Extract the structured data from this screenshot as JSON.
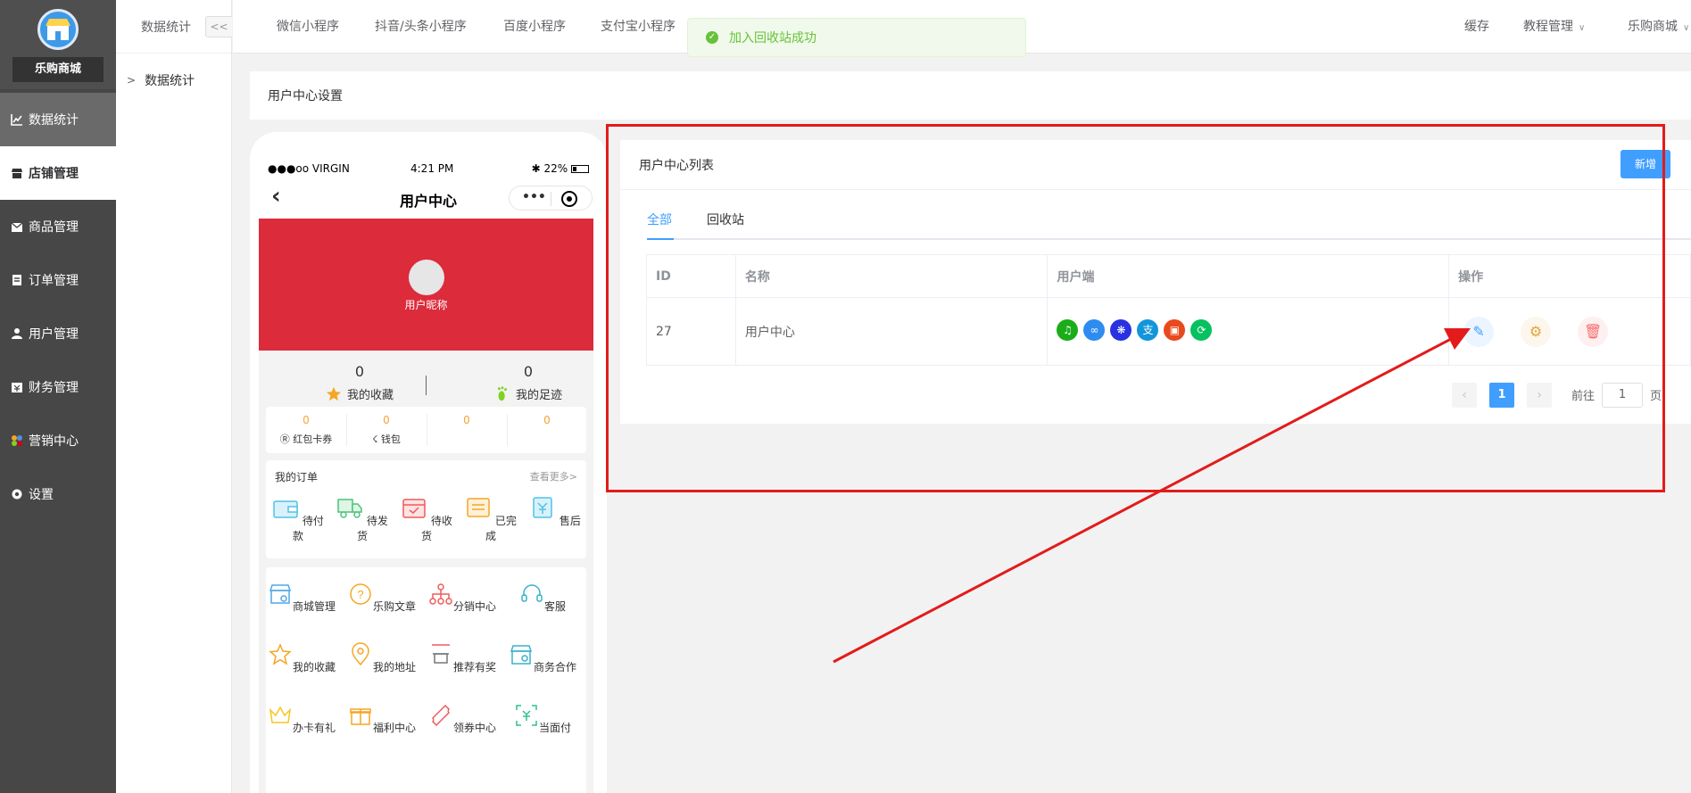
{
  "sidebar": {
    "brand": "乐购商城",
    "items": [
      {
        "label": "数据统计"
      },
      {
        "label": "店铺管理"
      },
      {
        "label": "商品管理"
      },
      {
        "label": "订单管理"
      },
      {
        "label": "用户管理"
      },
      {
        "label": "财务管理"
      },
      {
        "label": "营销中心"
      },
      {
        "label": "设置"
      }
    ]
  },
  "subnav": {
    "title": "数据统计",
    "collapse": "<<",
    "item": "数据统计"
  },
  "topbar": {
    "tabs": [
      "微信小程序",
      "抖音/头条小程序",
      "百度小程序",
      "支付宝小程序"
    ],
    "right": [
      "缓存",
      "教程管理",
      "乐购商城"
    ]
  },
  "toast": {
    "message": "加入回收站成功"
  },
  "page_title": "用户中心设置",
  "phone": {
    "carrier": "●●●oo VIRGIN",
    "time": "4:21 PM",
    "battery": "22%",
    "title": "用户中心",
    "nickname": "用户昵称",
    "stats": [
      {
        "value": "0",
        "label": "我的收藏"
      },
      {
        "value": "0",
        "label": "我的足迹"
      }
    ],
    "wallet": [
      {
        "value": "0",
        "label": "红包卡券"
      },
      {
        "value": "0",
        "label": "钱包"
      },
      {
        "value": "0",
        "label": ""
      },
      {
        "value": "0",
        "label": ""
      }
    ],
    "orders_title": "我的订单",
    "orders_more": "查看更多>",
    "orders": [
      "待付款",
      "待发货",
      "待收货",
      "已完成",
      "售后"
    ],
    "services": [
      "商城管理",
      "乐购文章",
      "分销中心",
      "客服",
      "我的收藏",
      "我的地址",
      "推荐有奖",
      "商务合作",
      "办卡有礼",
      "福利中心",
      "领券中心",
      "当面付"
    ]
  },
  "list": {
    "title": "用户中心列表",
    "add_label": "新增",
    "tabs": [
      "全部",
      "回收站"
    ],
    "columns": [
      "ID",
      "名称",
      "用户端",
      "操作"
    ],
    "rows": [
      {
        "id": "27",
        "name": "用户中心"
      }
    ],
    "pager": {
      "prev": "‹",
      "next": "›",
      "current": "1",
      "goto_prefix": "前往",
      "goto_value": "1",
      "goto_suffix": "页"
    }
  },
  "colors": {
    "accent": "#409eff",
    "banner": "#dc2b3b",
    "annotation": "#e31b1b",
    "success": "#67c23a"
  }
}
